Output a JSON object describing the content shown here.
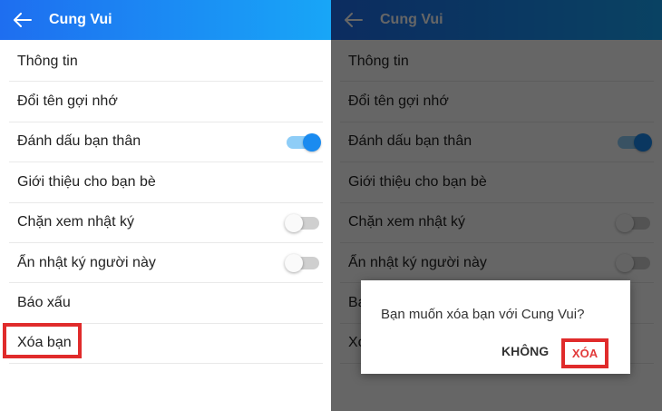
{
  "header": {
    "title": "Cung Vui"
  },
  "menu": [
    {
      "label": "Thông tin"
    },
    {
      "label": "Đổi tên gợi nhớ"
    },
    {
      "label": "Đánh dấu bạn thân",
      "toggle": true
    },
    {
      "label": "Giới thiệu cho bạn bè"
    },
    {
      "label": "Chặn xem nhật ký",
      "toggle": false
    },
    {
      "label": "Ẩn nhật ký người này",
      "toggle": false
    },
    {
      "label": "Báo xấu"
    },
    {
      "label": "Xóa bạn"
    }
  ],
  "dialog": {
    "message": "Bạn muốn xóa bạn với Cung Vui?",
    "cancel_label": "KHÔNG",
    "confirm_label": "XÓA"
  },
  "colors": {
    "header_start": "#1e6ef0",
    "header_end": "#18a6f7",
    "toggle_on": "#1a8bf0",
    "highlight": "#e02b2b",
    "confirm_text": "#e23a3a"
  },
  "icons": {
    "back": "arrow-left-icon"
  }
}
